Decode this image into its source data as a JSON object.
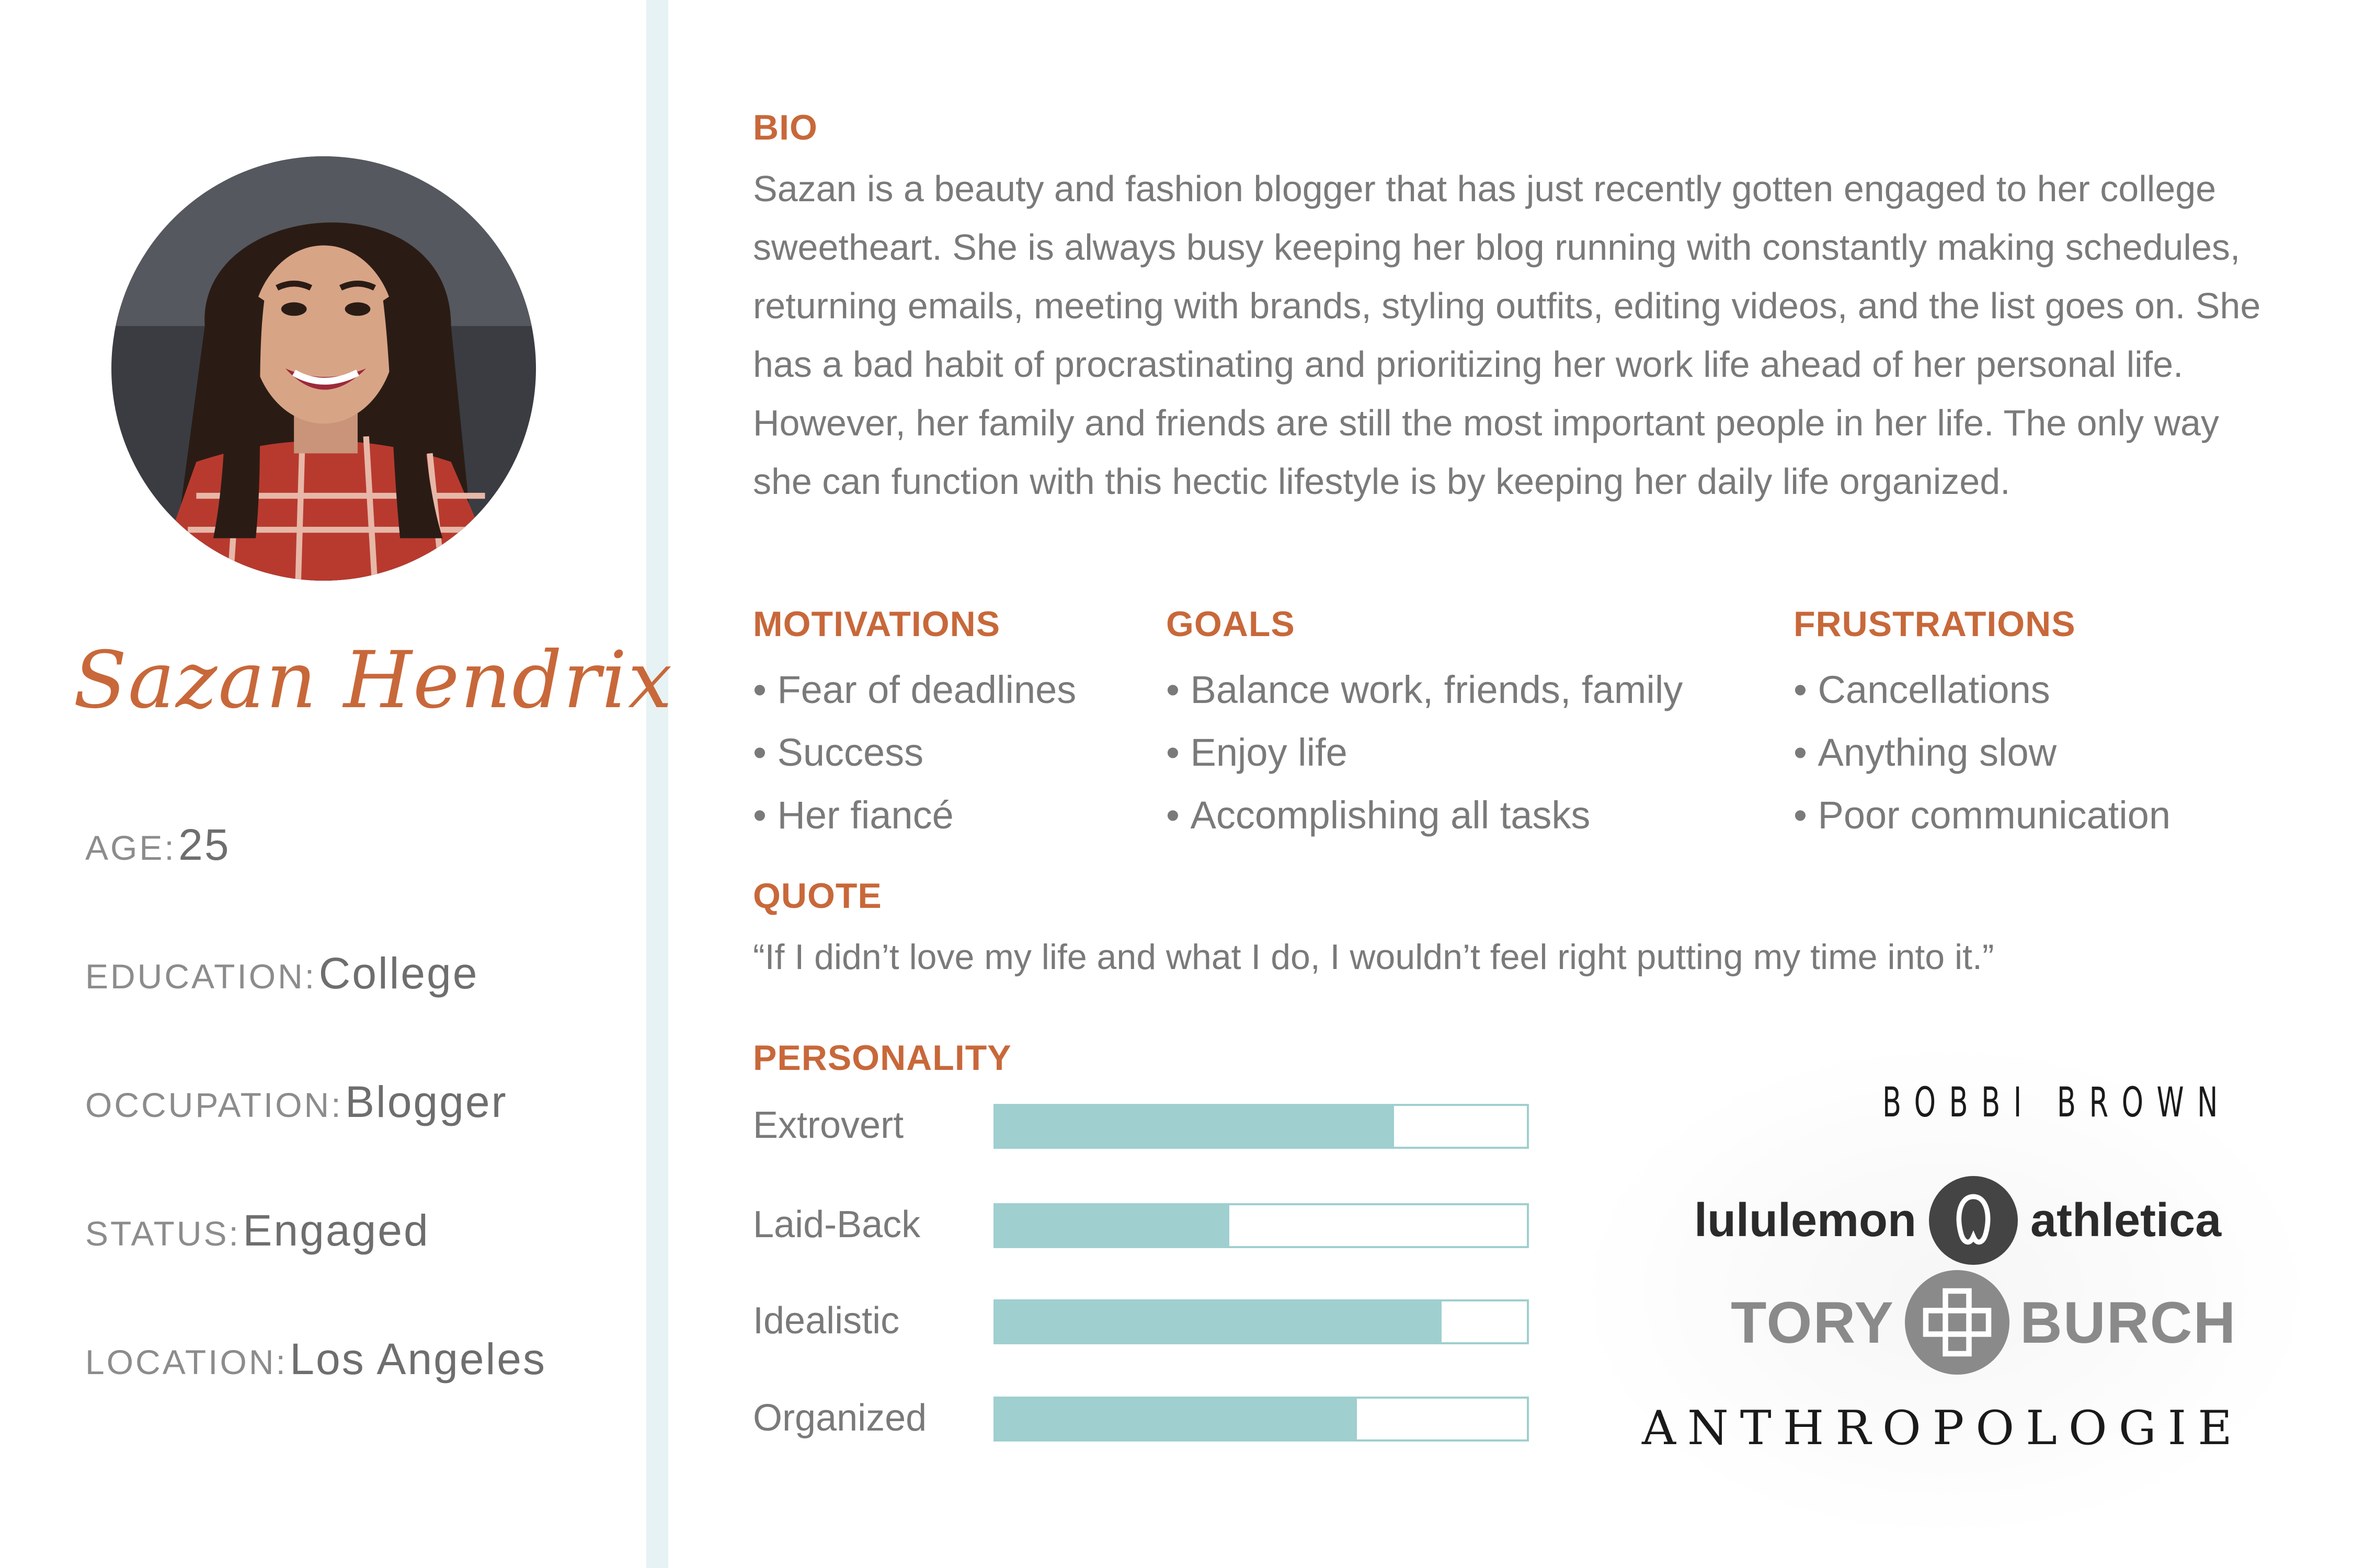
{
  "person": {
    "name": "Sazan Hendrix",
    "facts": [
      {
        "label": "AGE:",
        "value": "25"
      },
      {
        "label": "EDUCATION:",
        "value": "College"
      },
      {
        "label": "OCCUPATION:",
        "value": "Blogger"
      },
      {
        "label": "STATUS:",
        "value": "Engaged"
      },
      {
        "label": "LOCATION:",
        "value": "Los Angeles"
      }
    ]
  },
  "bio": {
    "heading": "BIO",
    "text": "Sazan is a beauty and fashion blogger that has just recently gotten engaged to her college sweetheart. She is always busy keeping her blog running with constantly making schedules, returning emails, meeting with brands, styling outfits, editing videos, and the list goes on. She has a bad habit of procrastinating and prioritizing her work life ahead of her personal life. However, her family and friends are still the most important people in her life. The only way she can function with this hectic lifestyle is by keeping her daily life organized."
  },
  "motivations": {
    "heading": "MOTIVATIONS",
    "items": [
      "Fear of deadlines",
      "Success",
      "Her fiancé"
    ]
  },
  "goals": {
    "heading": "GOALS",
    "items": [
      "Balance work, friends, family",
      "Enjoy life",
      "Accomplishing all tasks"
    ]
  },
  "frustrations": {
    "heading": "FRUSTRATIONS",
    "items": [
      "Cancellations",
      "Anything slow",
      "Poor communication"
    ]
  },
  "quote": {
    "heading": "QUOTE",
    "text": "“If I didn’t love my life and what I do, I wouldn’t feel right putting my time into it.”"
  },
  "personality": {
    "heading": "PERSONALITY",
    "traits": [
      {
        "label": "Extrovert",
        "level": 0.75
      },
      {
        "label": "Laid-Back",
        "level": 0.44
      },
      {
        "label": "Idealistic",
        "level": 0.84
      },
      {
        "label": "Organized",
        "level": 0.68
      }
    ]
  },
  "brands": {
    "bobbi": "BOBBI BROWN",
    "lulu_left": "lululemon",
    "lulu_right": "athletica",
    "tory_left": "TORY",
    "tory_right": "BURCH",
    "anthro": "ANTHROPOLOGIE"
  },
  "colors": {
    "accent": "#c8683a",
    "bar": "#9fcfcf",
    "divider": "#e6f2f3",
    "text": "#7a7a7a"
  }
}
